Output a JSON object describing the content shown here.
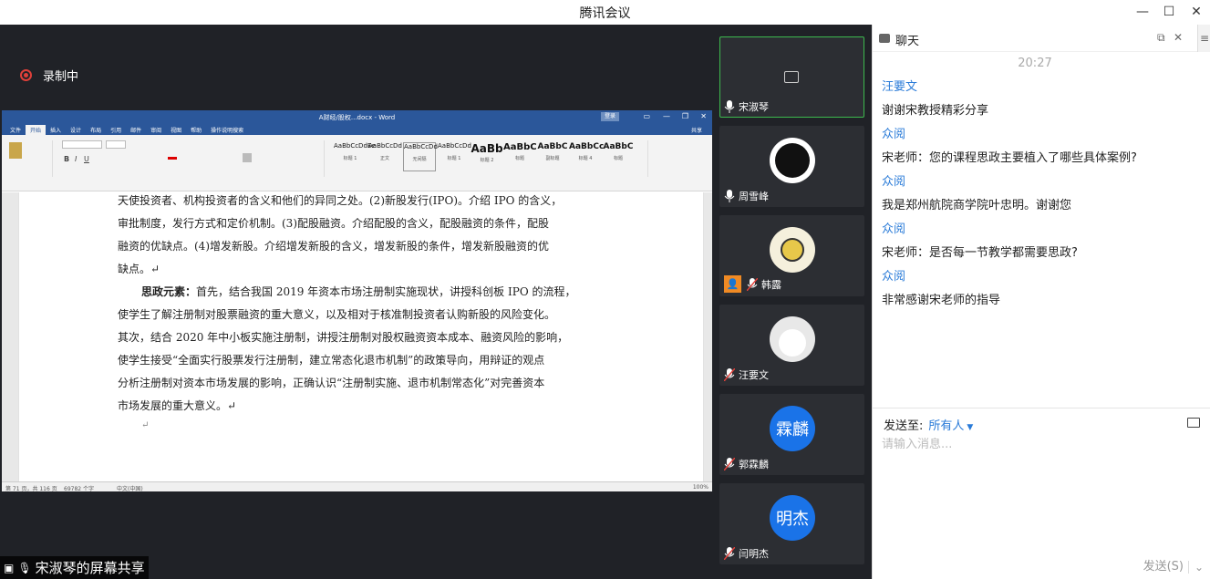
{
  "window": {
    "title": "腾讯会议"
  },
  "recording": {
    "label": "录制中"
  },
  "word": {
    "title": "A财经/股权...docx - Word",
    "login": "登录",
    "tabs": [
      "文件",
      "开始",
      "插入",
      "设计",
      "布局",
      "引用",
      "邮件",
      "审阅",
      "视图",
      "帮助",
      "操作说明搜索"
    ],
    "share_btn": "共享",
    "styles": [
      {
        "preview": "AaBbCcDdEe",
        "name": "标题 1"
      },
      {
        "preview": "AaBbCcDd",
        "name": "正文"
      },
      {
        "preview": "AaBbCcDd",
        "name": "无间隔"
      },
      {
        "preview": "AaBbCcDd",
        "name": "标题 1"
      },
      {
        "preview": "AaBb",
        "name": "标题 2"
      },
      {
        "preview": "AaBbC",
        "name": "标题"
      },
      {
        "preview": "AaBbC",
        "name": "副标题"
      },
      {
        "preview": "AaBbCc",
        "name": "标题 4"
      },
      {
        "preview": "AaBbC",
        "name": "标题"
      }
    ],
    "doc_lines": [
      "天使投资者、机构投资者的含义和他们的异同之处。(2)新股发行(IPO)。介绍 IPO 的含义，",
      "审批制度，发行方式和定价机制。(3)配股融资。介绍配股的含义，配股融资的条件，配股",
      "融资的优缺点。(4)增发新股。介绍增发新股的含义，增发新股的条件，增发新股融资的优",
      "缺点。↵"
    ],
    "ideology_label": "思政元素：",
    "ideology_lines": [
      "首先，结合我国 2019 年资本市场注册制实施现状，讲授科创板 IPO 的流程，",
      "使学生了解注册制对股票融资的重大意义，以及相对于核准制投资者认购新股的风险变化。",
      "其次，结合 2020 年中小板实施注册制，讲授注册制对股权融资资本成本、融资风险的影响，",
      "使学生接受“全面实行股票发行注册制，建立常态化退市机制”的政策导向，用辩证的观点",
      "分析注册制对资本市场发展的影响，正确认识“注册制实施、退市机制常态化”对完善资本",
      "市场发展的重大意义。↵"
    ],
    "empty_line": "↵",
    "status_page": "第 71 页，共 116 页",
    "status_words": "69782 个字",
    "status_lang": "中文(中国)",
    "status_zoom": "100%"
  },
  "share_label": "宋淑琴的屏幕共享",
  "participants": [
    {
      "name": "宋淑琴",
      "avatar_text": "",
      "avatar_color": "#2c2e33",
      "mic": "on",
      "video_off": true,
      "active": true
    },
    {
      "name": "周雪峰",
      "avatar_text": "",
      "avatar_color": "#ffffff",
      "mic": "on",
      "video_off": false,
      "active": false
    },
    {
      "name": "韩露",
      "avatar_text": "",
      "avatar_color": "#f5f0dc",
      "mic": "off",
      "host": true,
      "active": false
    },
    {
      "name": "汪要文",
      "avatar_text": "",
      "avatar_color": "#e8e8e8",
      "mic": "off",
      "active": false
    },
    {
      "name": "郭霖麟",
      "avatar_text": "霖麟",
      "avatar_color": "#1a73e8",
      "mic": "off",
      "active": false
    },
    {
      "name": "闫明杰",
      "avatar_text": "明杰",
      "avatar_color": "#1a73e8",
      "mic": "off",
      "active": false
    }
  ],
  "chat": {
    "title": "聊天",
    "time": "20:27",
    "messages": [
      {
        "sender": "汪要文",
        "text": "谢谢宋教授精彩分享"
      },
      {
        "sender": "众阅",
        "text": "宋老师：您的课程思政主要植入了哪些具体案例?"
      },
      {
        "sender": "众阅",
        "text": "我是郑州航院商学院叶忠明。谢谢您"
      },
      {
        "sender": "众阅",
        "text": "宋老师：是否每一节教学都需要思政?"
      },
      {
        "sender": "众阅",
        "text": "非常感谢宋老师的指导"
      }
    ],
    "send_to_label": "发送至:",
    "send_to_value": "所有人",
    "input_placeholder": "请输入消息...",
    "send_button": "发送(S)"
  },
  "colors": {
    "accent": "#2a7bd8",
    "record": "#e0403a",
    "active_border": "#3dba4e",
    "word_blue": "#2b579a"
  }
}
